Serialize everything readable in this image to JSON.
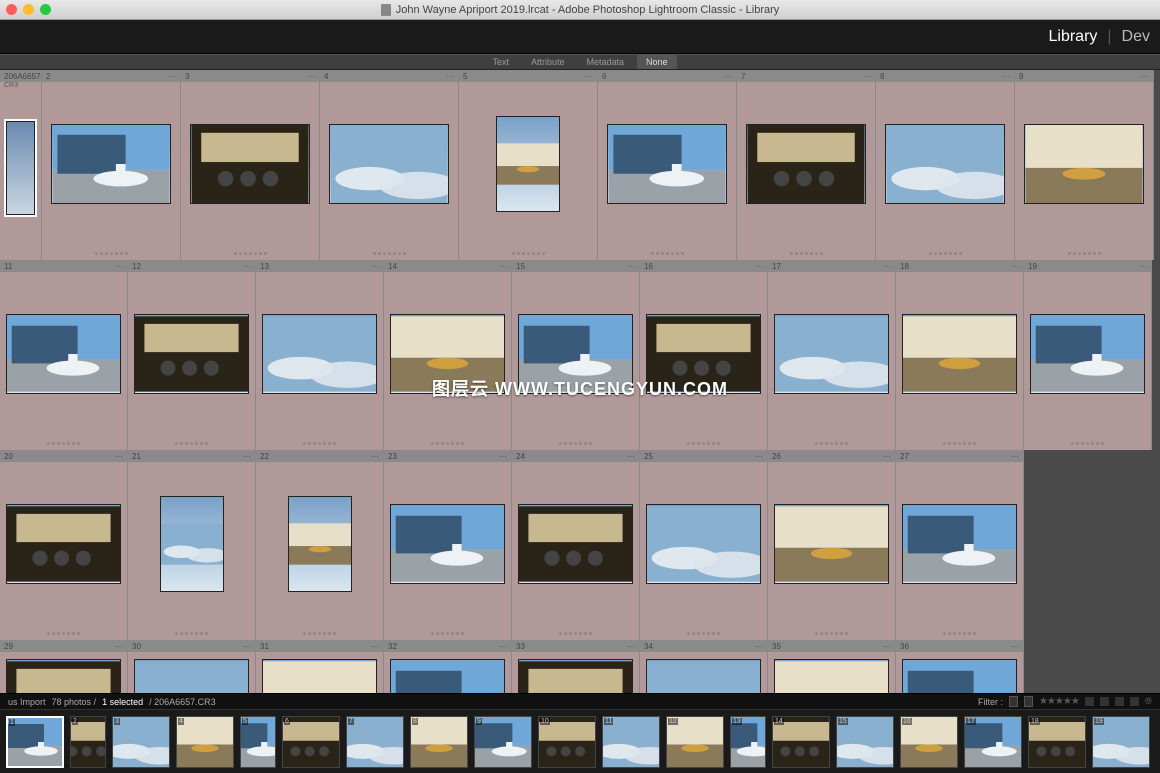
{
  "titlebar": {
    "title": "John Wayne Apriport 2019.lrcat - Adobe Photoshop Lightroom Classic - Library"
  },
  "modules": {
    "library": "Library",
    "develop": "Dev"
  },
  "filter_tabs": {
    "text": "Text",
    "attribute": "Attribute",
    "metadata": "Metadata",
    "none": "None"
  },
  "grid": {
    "first_cell": {
      "filename": "206A6657",
      "ext": "CR3"
    },
    "rows": [
      {
        "start_index": 2,
        "count": 8,
        "orientations": [
          "l",
          "l",
          "l",
          "p",
          "l",
          "l",
          "l",
          "l"
        ]
      },
      {
        "start_index": 11,
        "count": 9,
        "orientations": [
          "l",
          "l",
          "l",
          "l",
          "l",
          "l",
          "l",
          "l",
          "l"
        ]
      },
      {
        "start_index": 20,
        "count": 8,
        "orientations": [
          "l",
          "p",
          "p",
          "l",
          "l",
          "l",
          "l",
          "l"
        ]
      },
      {
        "start_index": 29,
        "count": 8,
        "orientations": [
          "l",
          "l",
          "l",
          "l",
          "l",
          "l",
          "l",
          "l"
        ]
      }
    ]
  },
  "status": {
    "left_prefix": "us Import",
    "photos": "78 photos /",
    "selected": "1 selected",
    "filename": "/ 206A6657.CR3",
    "filter_label": "Filter :"
  },
  "filmstrip": {
    "count": 19
  },
  "watermark": "图层云 WWW.TUCENGYUN.COM",
  "colors": {
    "cell_bg": "#b29999",
    "header_bg": "#8a8a8a",
    "grid_bg": "#4a4a4a"
  }
}
